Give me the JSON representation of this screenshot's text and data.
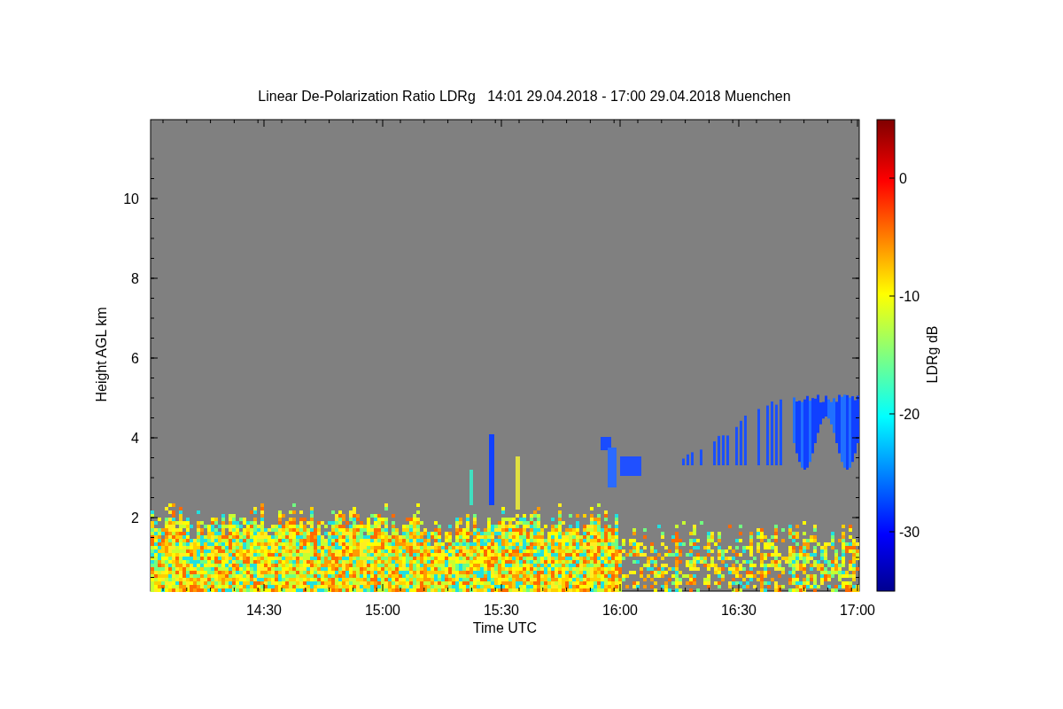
{
  "title": "Linear De-Polarization Ratio LDRg   14:01 29.04.2018 - 17:00 29.04.2018 Muenchen",
  "plot": {
    "xlabel": "Time UTC",
    "ylabel": "Height AGL km",
    "xticks": [
      "14:30",
      "15:00",
      "15:30",
      "16:00",
      "16:30",
      "17:00"
    ],
    "yticks": [
      "10",
      "8",
      "6",
      "4",
      "2"
    ]
  },
  "colorbar": {
    "label": "LDRg dB",
    "ticks": [
      "0",
      "-10",
      "-20",
      "-30"
    ]
  }
}
